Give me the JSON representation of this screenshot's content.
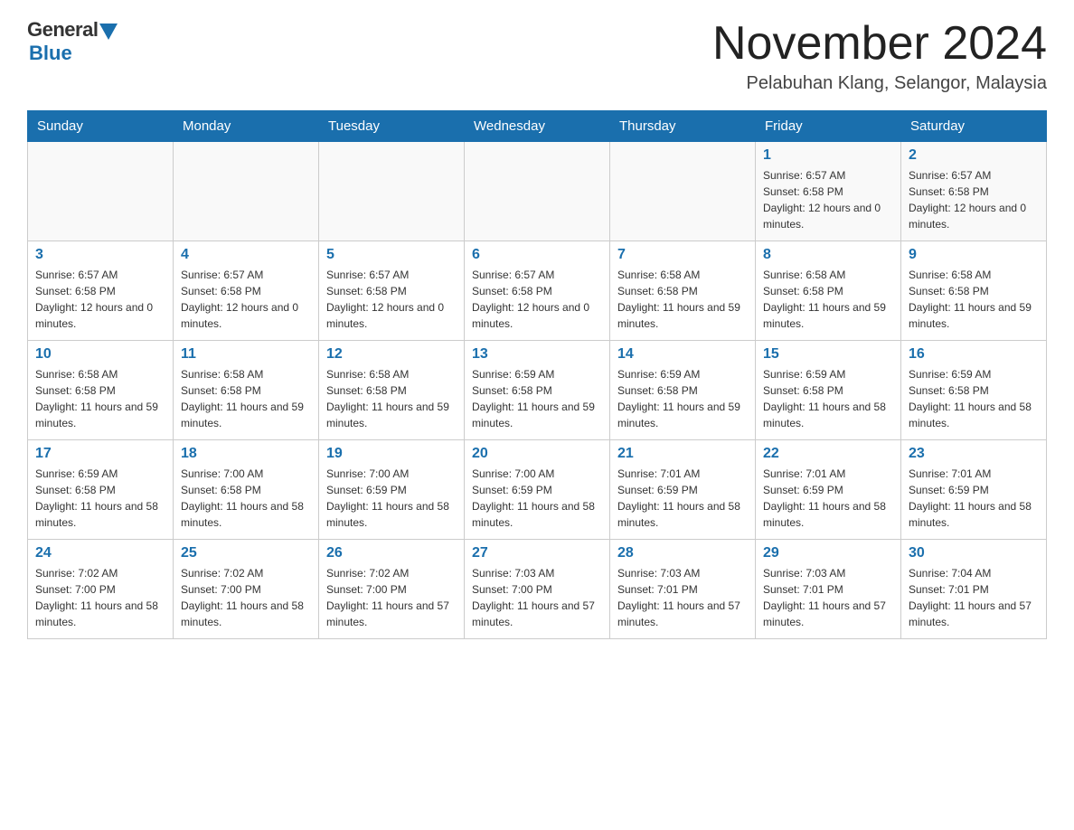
{
  "header": {
    "logo_general": "General",
    "logo_blue": "Blue",
    "month_title": "November 2024",
    "location": "Pelabuhan Klang, Selangor, Malaysia"
  },
  "days_of_week": [
    "Sunday",
    "Monday",
    "Tuesday",
    "Wednesday",
    "Thursday",
    "Friday",
    "Saturday"
  ],
  "weeks": [
    [
      {
        "day": "",
        "info": ""
      },
      {
        "day": "",
        "info": ""
      },
      {
        "day": "",
        "info": ""
      },
      {
        "day": "",
        "info": ""
      },
      {
        "day": "",
        "info": ""
      },
      {
        "day": "1",
        "info": "Sunrise: 6:57 AM\nSunset: 6:58 PM\nDaylight: 12 hours and 0 minutes."
      },
      {
        "day": "2",
        "info": "Sunrise: 6:57 AM\nSunset: 6:58 PM\nDaylight: 12 hours and 0 minutes."
      }
    ],
    [
      {
        "day": "3",
        "info": "Sunrise: 6:57 AM\nSunset: 6:58 PM\nDaylight: 12 hours and 0 minutes."
      },
      {
        "day": "4",
        "info": "Sunrise: 6:57 AM\nSunset: 6:58 PM\nDaylight: 12 hours and 0 minutes."
      },
      {
        "day": "5",
        "info": "Sunrise: 6:57 AM\nSunset: 6:58 PM\nDaylight: 12 hours and 0 minutes."
      },
      {
        "day": "6",
        "info": "Sunrise: 6:57 AM\nSunset: 6:58 PM\nDaylight: 12 hours and 0 minutes."
      },
      {
        "day": "7",
        "info": "Sunrise: 6:58 AM\nSunset: 6:58 PM\nDaylight: 11 hours and 59 minutes."
      },
      {
        "day": "8",
        "info": "Sunrise: 6:58 AM\nSunset: 6:58 PM\nDaylight: 11 hours and 59 minutes."
      },
      {
        "day": "9",
        "info": "Sunrise: 6:58 AM\nSunset: 6:58 PM\nDaylight: 11 hours and 59 minutes."
      }
    ],
    [
      {
        "day": "10",
        "info": "Sunrise: 6:58 AM\nSunset: 6:58 PM\nDaylight: 11 hours and 59 minutes."
      },
      {
        "day": "11",
        "info": "Sunrise: 6:58 AM\nSunset: 6:58 PM\nDaylight: 11 hours and 59 minutes."
      },
      {
        "day": "12",
        "info": "Sunrise: 6:58 AM\nSunset: 6:58 PM\nDaylight: 11 hours and 59 minutes."
      },
      {
        "day": "13",
        "info": "Sunrise: 6:59 AM\nSunset: 6:58 PM\nDaylight: 11 hours and 59 minutes."
      },
      {
        "day": "14",
        "info": "Sunrise: 6:59 AM\nSunset: 6:58 PM\nDaylight: 11 hours and 59 minutes."
      },
      {
        "day": "15",
        "info": "Sunrise: 6:59 AM\nSunset: 6:58 PM\nDaylight: 11 hours and 58 minutes."
      },
      {
        "day": "16",
        "info": "Sunrise: 6:59 AM\nSunset: 6:58 PM\nDaylight: 11 hours and 58 minutes."
      }
    ],
    [
      {
        "day": "17",
        "info": "Sunrise: 6:59 AM\nSunset: 6:58 PM\nDaylight: 11 hours and 58 minutes."
      },
      {
        "day": "18",
        "info": "Sunrise: 7:00 AM\nSunset: 6:58 PM\nDaylight: 11 hours and 58 minutes."
      },
      {
        "day": "19",
        "info": "Sunrise: 7:00 AM\nSunset: 6:59 PM\nDaylight: 11 hours and 58 minutes."
      },
      {
        "day": "20",
        "info": "Sunrise: 7:00 AM\nSunset: 6:59 PM\nDaylight: 11 hours and 58 minutes."
      },
      {
        "day": "21",
        "info": "Sunrise: 7:01 AM\nSunset: 6:59 PM\nDaylight: 11 hours and 58 minutes."
      },
      {
        "day": "22",
        "info": "Sunrise: 7:01 AM\nSunset: 6:59 PM\nDaylight: 11 hours and 58 minutes."
      },
      {
        "day": "23",
        "info": "Sunrise: 7:01 AM\nSunset: 6:59 PM\nDaylight: 11 hours and 58 minutes."
      }
    ],
    [
      {
        "day": "24",
        "info": "Sunrise: 7:02 AM\nSunset: 7:00 PM\nDaylight: 11 hours and 58 minutes."
      },
      {
        "day": "25",
        "info": "Sunrise: 7:02 AM\nSunset: 7:00 PM\nDaylight: 11 hours and 58 minutes."
      },
      {
        "day": "26",
        "info": "Sunrise: 7:02 AM\nSunset: 7:00 PM\nDaylight: 11 hours and 57 minutes."
      },
      {
        "day": "27",
        "info": "Sunrise: 7:03 AM\nSunset: 7:00 PM\nDaylight: 11 hours and 57 minutes."
      },
      {
        "day": "28",
        "info": "Sunrise: 7:03 AM\nSunset: 7:01 PM\nDaylight: 11 hours and 57 minutes."
      },
      {
        "day": "29",
        "info": "Sunrise: 7:03 AM\nSunset: 7:01 PM\nDaylight: 11 hours and 57 minutes."
      },
      {
        "day": "30",
        "info": "Sunrise: 7:04 AM\nSunset: 7:01 PM\nDaylight: 11 hours and 57 minutes."
      }
    ]
  ]
}
